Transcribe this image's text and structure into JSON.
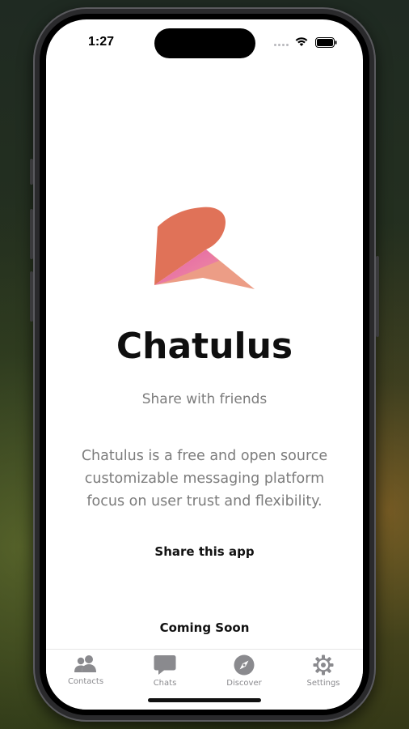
{
  "status_bar": {
    "time": "1:27"
  },
  "app": {
    "title": "Chatulus",
    "tagline": "Share with friends",
    "description": "Chatulus is a free and open source customizable messaging platform focus on user trust and flexibility.",
    "share_label": "Share this app",
    "coming_soon_label": "Coming Soon"
  },
  "tabs": [
    {
      "label": "Contacts",
      "icon": "contacts-icon"
    },
    {
      "label": "Chats",
      "icon": "chat-bubble-icon"
    },
    {
      "label": "Discover",
      "icon": "compass-icon"
    },
    {
      "label": "Settings",
      "icon": "gear-icon"
    }
  ],
  "colors": {
    "logo_primary": "#e07258",
    "logo_pink": "#e86aa8",
    "logo_light": "#eea690",
    "tab_icon": "#8a8a8e",
    "text_muted": "#7c7c7c"
  }
}
